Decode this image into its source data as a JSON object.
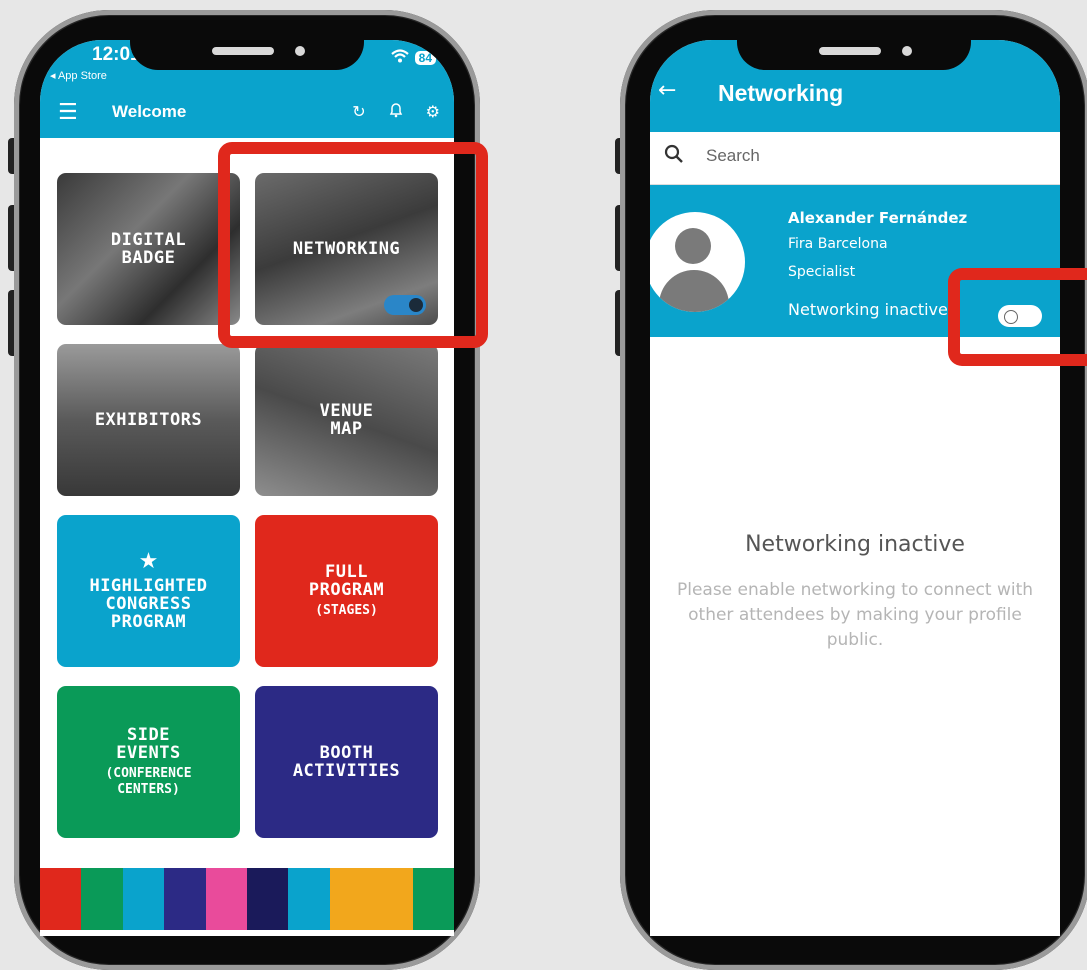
{
  "left_phone": {
    "status": {
      "time": "12:01",
      "back_app": "◂ App Store",
      "battery": "84"
    },
    "appbar": {
      "title": "Welcome"
    },
    "tiles": [
      {
        "label": "DIGITAL\nBADGE",
        "sub": ""
      },
      {
        "label": "NETWORKING",
        "sub": ""
      },
      {
        "label": "EXHIBITORS",
        "sub": ""
      },
      {
        "label": "VENUE\nMAP",
        "sub": ""
      },
      {
        "label": "HIGHLIGHTED\nCONGRESS\nPROGRAM",
        "sub": ""
      },
      {
        "label": "FULL\nPROGRAM",
        "sub": "(STAGES)"
      },
      {
        "label": "SIDE\nEVENTS",
        "sub": "(CONFERENCE\nCENTERS)"
      },
      {
        "label": "BOOTH\nACTIVITIES",
        "sub": ""
      }
    ],
    "networking_toggle_on": true,
    "colors": {
      "accent": "#0aa3cc",
      "highlight": "#e0281c",
      "red_tile": "#e0281c",
      "blue_tile": "#0aa3cc",
      "green_tile": "#0a9a58",
      "navy_tile": "#2c2a85"
    }
  },
  "right_phone": {
    "appbar": {
      "title": "Networking"
    },
    "search": {
      "placeholder": "Search"
    },
    "profile": {
      "name": "Alexander Fernández",
      "organization": "Fira Barcelona",
      "role": "Specialist",
      "status": "Networking inactive"
    },
    "networking_toggle_on": false,
    "empty_state": {
      "title": "Networking inactive",
      "message": "Please enable networking to connect with other attendees by making your profile public."
    }
  }
}
